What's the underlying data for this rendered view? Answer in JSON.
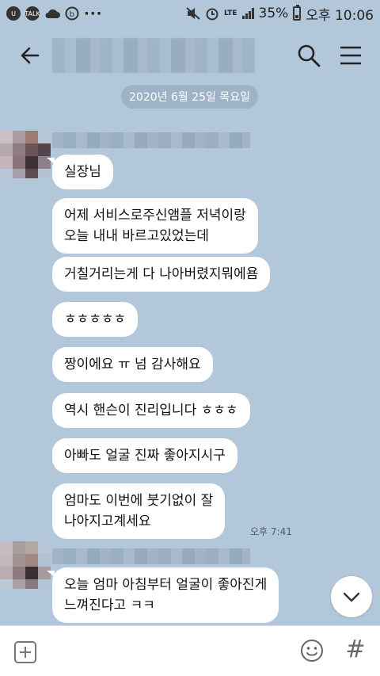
{
  "status_bar": {
    "talk_icon_label": "TALK",
    "more": "···",
    "network": "LTE",
    "battery": "35%",
    "time": "오후 10:06"
  },
  "header": {
    "icons": [
      "back-arrow-icon",
      "search-icon",
      "menu-icon"
    ]
  },
  "date_divider": "2020년 6월 25일 목요일",
  "messages": [
    {
      "text": "실장님"
    },
    {
      "text": "어제 서비스로주신앰플 저녁이랑\n오늘 내내 바르고있었는데"
    },
    {
      "text": "거칠거리는게 다 나아버렸지뭐에욤"
    },
    {
      "text": "ㅎㅎㅎㅎㅎ"
    },
    {
      "text": "짱이에요 ㅠ 넘 감사해요"
    },
    {
      "text": "역시 핸슨이 진리입니다 ㅎㅎㅎ"
    },
    {
      "text": "아빠도 얼굴 진짜 좋아지시구"
    },
    {
      "text": "엄마도 이번에 붓기없이 잘\n나아지고계세요",
      "time": "오후 7:41"
    },
    {
      "text": "오늘 엄마 아침부터 얼굴이 좋아진게\n느껴진다고 ㅋㅋ"
    }
  ],
  "input": {
    "value": "",
    "placeholder": ""
  },
  "colors": {
    "background": "#b2c7d9",
    "bubble": "#ffffff",
    "date_pill": "#9fb3c6"
  }
}
